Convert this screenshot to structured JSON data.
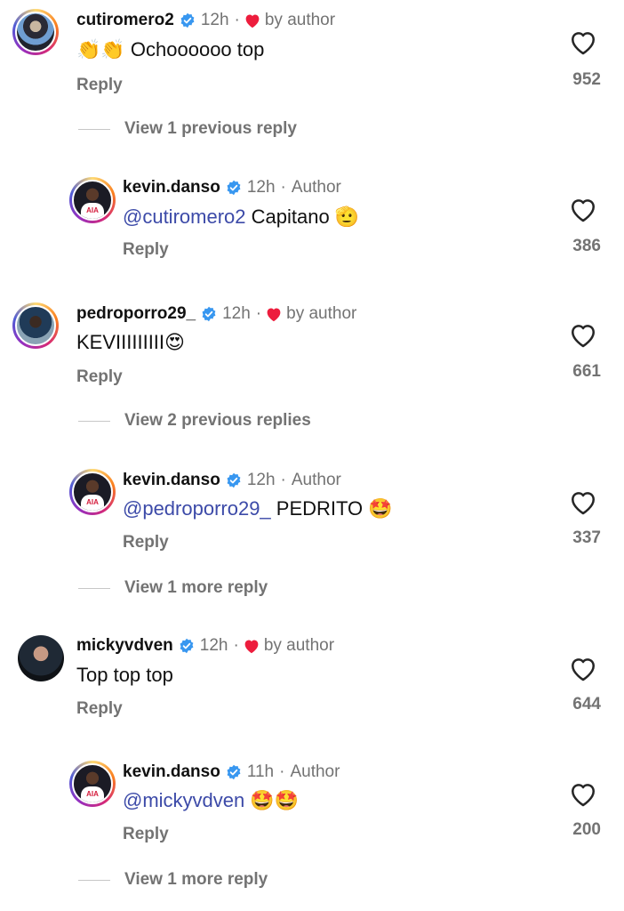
{
  "comments": [
    {
      "username": "cutiromero2",
      "time": "12h",
      "liked_by": "by author",
      "emoji_prefix": "👏👏",
      "text": " Ochoooooo top",
      "reply": "Reply",
      "likes": "952"
    },
    {
      "username": "kevin.danso",
      "time": "12h",
      "author_tag": "Author",
      "mention": "@cutiromero2",
      "text": " Capitano ",
      "emoji": "🫡",
      "reply": "Reply",
      "likes": "386"
    },
    {
      "username": "pedroporro29_",
      "time": "12h",
      "liked_by": "by author",
      "text": "KEVIIIIIIIII",
      "emoji": "😍",
      "reply": "Reply",
      "likes": "661"
    },
    {
      "username": "kevin.danso",
      "time": "12h",
      "author_tag": "Author",
      "mention": "@pedroporro29_",
      "text": " PEDRITO ",
      "emoji": "🤩",
      "reply": "Reply",
      "likes": "337"
    },
    {
      "username": "mickyvdven",
      "time": "12h",
      "liked_by": "by author",
      "text": "Top top top",
      "reply": "Reply",
      "likes": "644"
    },
    {
      "username": "kevin.danso",
      "time": "11h",
      "author_tag": "Author",
      "mention": "@mickyvdven",
      "text": " ",
      "emoji": "🤩🤩",
      "reply": "Reply",
      "likes": "200"
    }
  ],
  "view_replies": [
    "View 1 previous reply",
    "View 2 previous replies",
    "View 1 more reply",
    "View 1 more reply"
  ],
  "dot": "·",
  "colors": {
    "verified": "#3897f0",
    "heart": "#ed1d3d",
    "mention": "#3c4aa8",
    "muted": "#737373"
  },
  "icons": {
    "like": "heart-outline-icon",
    "verified": "verified-badge-icon",
    "liked_by_author": "heart-filled-icon"
  }
}
